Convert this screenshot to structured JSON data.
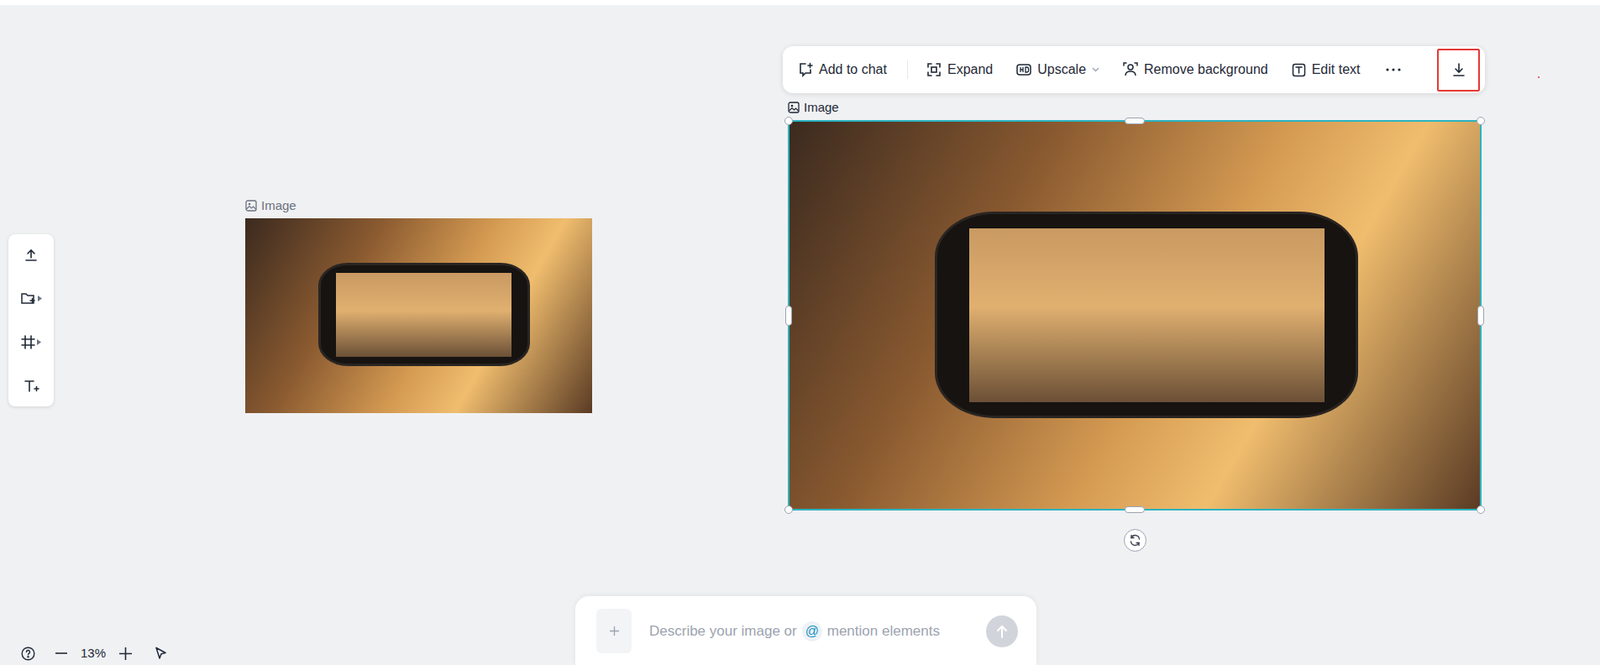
{
  "canvas": {
    "elements": [
      {
        "label": "Image",
        "selected": false
      },
      {
        "label": "Image",
        "selected": true
      }
    ]
  },
  "toolbar": {
    "buttons": [
      "Add to chat",
      "Expand",
      "Upscale",
      "Remove background",
      "Edit text"
    ],
    "download_highlighted": true
  },
  "prompt": {
    "placeholder_before": "Describe your image or",
    "mention": "@",
    "placeholder_after": "mention elements"
  },
  "zoom": {
    "level": "13%"
  }
}
